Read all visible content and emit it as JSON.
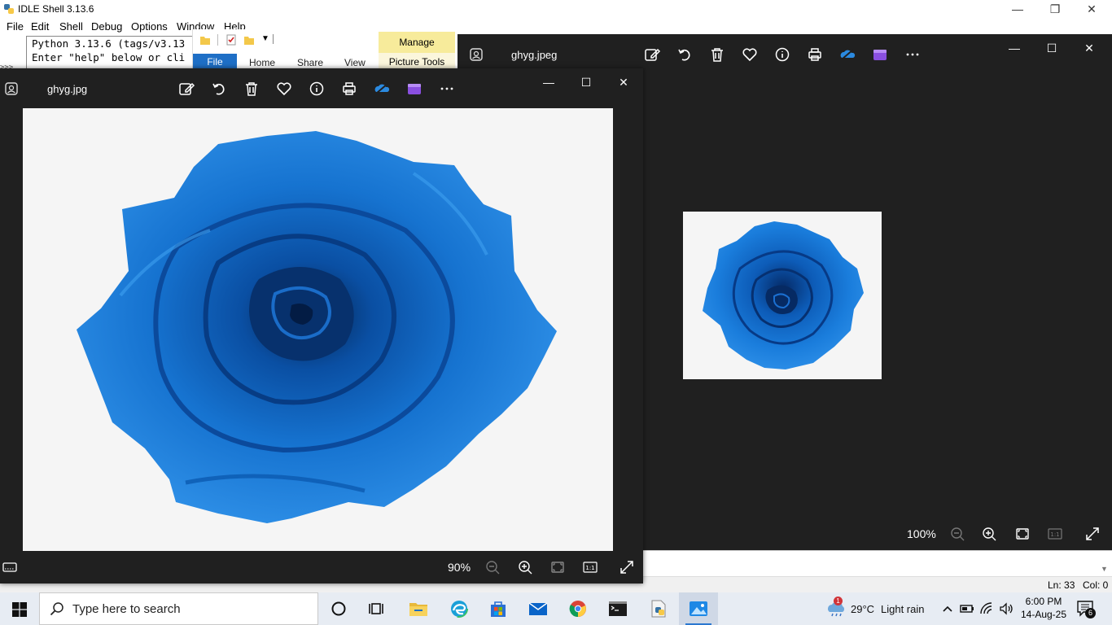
{
  "idle": {
    "title": "IDLE Shell 3.13.6",
    "menu": [
      "File",
      "Edit",
      "Shell",
      "Debug",
      "Options",
      "Window",
      "Help"
    ],
    "shell_lines": [
      "Python 3.13.6 (tags/v3.13",
      "Enter \"help\" below or cli"
    ],
    "prompt": ">>>",
    "status_ln": "Ln: 33",
    "status_col": "Col: 0"
  },
  "ribbon": {
    "manage": "Manage",
    "tabs": [
      "File",
      "Home",
      "Share",
      "View"
    ],
    "picture_tools": "Picture Tools"
  },
  "photos_front": {
    "filename": "ghyg.jpg",
    "zoom": "90%"
  },
  "photos_back": {
    "filename": "ghyg.jpeg",
    "zoom": "100%"
  },
  "taskbar": {
    "search_placeholder": "Type here to search",
    "weather_temp": "29°C",
    "weather_desc": "Light rain",
    "weather_badge": "1",
    "time": "6:00 PM",
    "date": "14-Aug-25",
    "notification_count": "6"
  },
  "colors": {
    "photos_bg": "#202020",
    "rose_blue": "#1a78d2",
    "accent": "#2b78d0"
  }
}
